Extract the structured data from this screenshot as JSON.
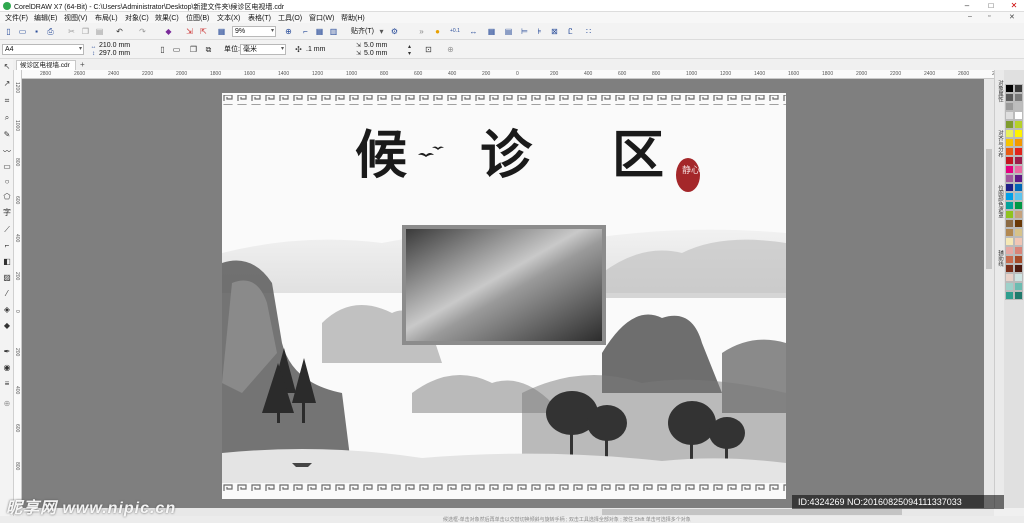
{
  "window": {
    "title": "CorelDRAW X7 (64-Bit) - C:\\Users\\Administrator\\Desktop\\新建文件夹\\候诊区电视墙.cdr"
  },
  "menu": [
    "文件(F)",
    "编辑(E)",
    "视图(V)",
    "布局(L)",
    "对象(C)",
    "效果(C)",
    "位图(B)",
    "文本(X)",
    "表格(T)",
    "工具(O)",
    "窗口(W)",
    "帮助(H)"
  ],
  "toolbar": {
    "zoom": "9%",
    "snap_label": "贴齐(T)",
    "zoom_hint": "+0.1"
  },
  "property_bar": {
    "page_size": "A4",
    "width": "210.0 mm",
    "height": "297.0 mm",
    "units_label": "单位:",
    "units": "毫米",
    "nudge": ".1 mm",
    "dup_x": "5.0 mm",
    "dup_y": "5.0 mm"
  },
  "document_tab": "候诊区电视墙.cdr",
  "ruler_h": [
    "2800",
    "2600",
    "2400",
    "2200",
    "2000",
    "1800",
    "1600",
    "1400",
    "1200",
    "1000",
    "800",
    "600",
    "400",
    "200",
    "0",
    "200",
    "400",
    "600",
    "800",
    "1000",
    "1200",
    "1400",
    "1600",
    "1800",
    "2000",
    "2200",
    "2400",
    "2600",
    "2800",
    "3000",
    "3200",
    "3400",
    "3600",
    "3800",
    "4000",
    "4200"
  ],
  "ruler_v": [
    "1200",
    "1000",
    "800",
    "600",
    "400",
    "200",
    "0",
    "200",
    "400",
    "600",
    "800"
  ],
  "artwork": {
    "heading_chars": [
      "候",
      "诊",
      "区"
    ],
    "seal_text": "静心"
  },
  "dockers": [
    "对象属性",
    "对齐与分布",
    "位图颜色遮罩",
    "辅助线"
  ],
  "palette": [
    "#000000",
    "#3a3a3a",
    "#595959",
    "#7a7a7a",
    "#9a9a9a",
    "#bdbdbd",
    "#dedede",
    "#ffffff",
    "#7f9c2e",
    "#b6d12a",
    "#e8ef5a",
    "#fff200",
    "#f7c400",
    "#f39800",
    "#e85a12",
    "#e0231b",
    "#c3151f",
    "#9c1c4b",
    "#e4007f",
    "#ea68a2",
    "#a3599e",
    "#601986",
    "#1d2088",
    "#0068b7",
    "#00a0e9",
    "#5cc5ef",
    "#00a29a",
    "#009944",
    "#8fc31f",
    "#c6a27c",
    "#8b6a43",
    "#6a3906",
    "#b28850",
    "#d7c38a",
    "#f5e8b5",
    "#f0c6b5",
    "#e6a8a3",
    "#d98478",
    "#c86a4d",
    "#a64a28",
    "#7a2f1b",
    "#4c1a0f",
    "#e8d2c9",
    "#cfe4e2",
    "#9fd1ca",
    "#6cbcb1",
    "#2e9e8e",
    "#1f7a6c"
  ],
  "watermark": {
    "site": "昵享网 www.nipic.cn",
    "id_line": "ID:4324269 NO:20160825094111337033"
  },
  "status": "候选框-单击对象然后再单击以交替切换倾斜与旋转手柄 ; 双击工具选择全部对象 ; 按住 Shift 单击可选择多个对象"
}
